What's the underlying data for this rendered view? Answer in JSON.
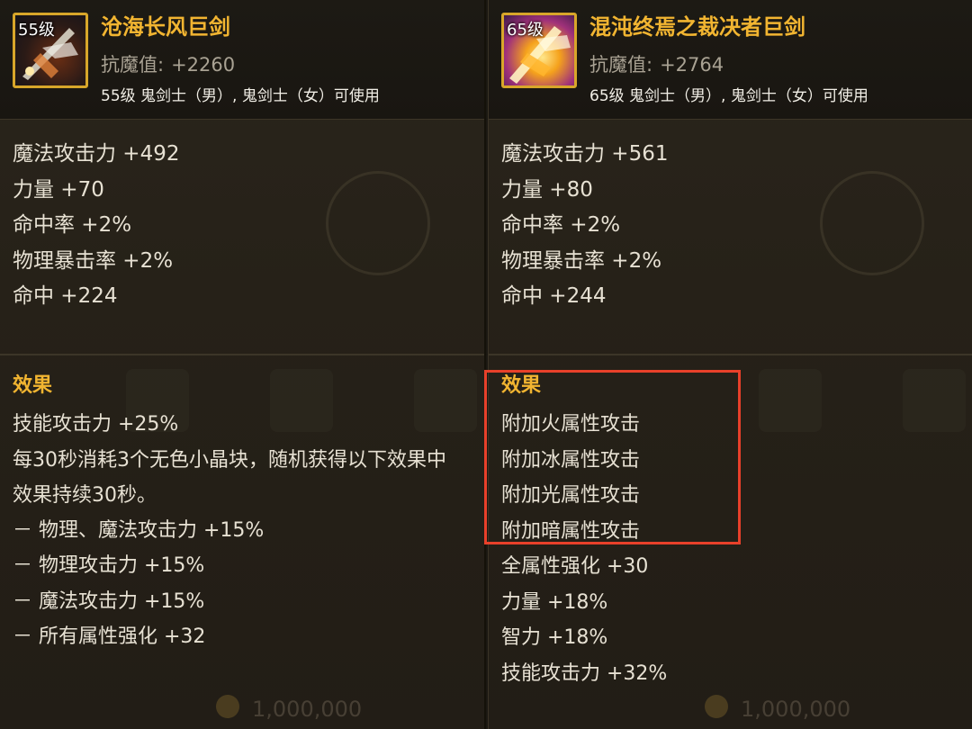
{
  "left_item": {
    "level_badge": "55级",
    "name": "沧海长风巨剑",
    "resist_label": "抗魔值:",
    "resist_value": "+2260",
    "usable": "55级 鬼剑士（男）, 鬼剑士（女）可使用",
    "stats": [
      "魔法攻击力 +492",
      "力量 +70",
      "命中率 +2%",
      "物理暴击率 +2%",
      "命中 +224"
    ],
    "effect_title": "效果",
    "effects": [
      "技能攻击力 +25%",
      "每30秒消耗3个无色小晶块，随机获得以下效果中",
      "效果持续30秒。",
      "－ 物理、魔法攻击力 +15%",
      "－ 物理攻击力 +15%",
      "－ 魔法攻击力 +15%",
      "－ 所有属性强化 +32"
    ],
    "footer_faded": "1,000,000"
  },
  "right_item": {
    "level_badge": "65级",
    "name": "混沌终焉之裁决者巨剑",
    "resist_label": "抗魔值:",
    "resist_value": "+2764",
    "usable": "65级 鬼剑士（男）, 鬼剑士（女）可使用",
    "stats": [
      "魔法攻击力 +561",
      "力量 +80",
      "命中率 +2%",
      "物理暴击率 +2%",
      "命中 +244"
    ],
    "effect_title": "效果",
    "effects": [
      "附加火属性攻击",
      "附加冰属性攻击",
      "附加光属性攻击",
      "附加暗属性攻击",
      "全属性强化 +30",
      "力量 +18%",
      "智力 +18%",
      "技能攻击力 +32%"
    ],
    "footer_faded": "1,000,000"
  },
  "colors": {
    "name": "#f2b531",
    "highlight": "#e8402a",
    "icon_border": "#d8a62a"
  }
}
